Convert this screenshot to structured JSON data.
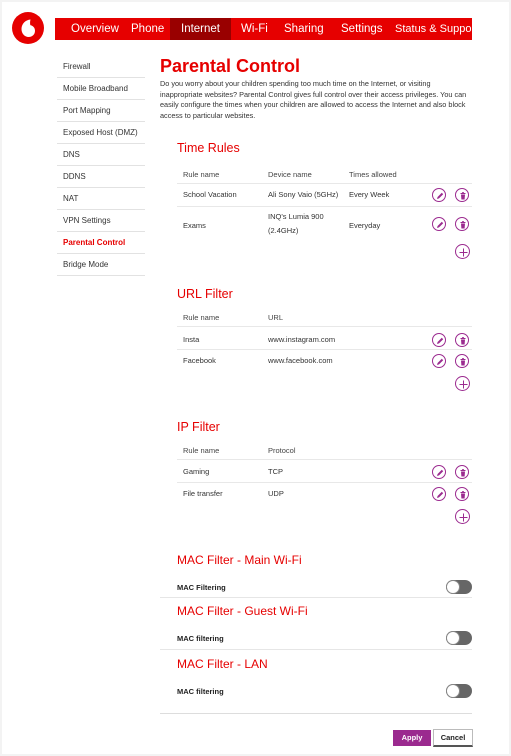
{
  "colors": {
    "brand": "#e60000",
    "brand_dark": "#990000",
    "action": "#9b2a8f"
  },
  "logo": {
    "icon": "vodafone-logo"
  },
  "nav": {
    "items": [
      {
        "label": "Overview"
      },
      {
        "label": "Phone"
      },
      {
        "label": "Internet",
        "active": true
      },
      {
        "label": "Wi-Fi"
      },
      {
        "label": "Sharing"
      },
      {
        "label": "Settings"
      },
      {
        "label": "Status & Support"
      }
    ]
  },
  "sidebar": {
    "items": [
      {
        "label": "Firewall"
      },
      {
        "label": "Mobile Broadband"
      },
      {
        "label": "Port Mapping"
      },
      {
        "label": "Exposed Host (DMZ)"
      },
      {
        "label": "DNS"
      },
      {
        "label": "DDNS"
      },
      {
        "label": "NAT"
      },
      {
        "label": "VPN Settings"
      },
      {
        "label": "Parental Control",
        "active": true
      },
      {
        "label": "Bridge Mode"
      }
    ]
  },
  "main": {
    "title": "Parental Control",
    "intro": "Do you worry about your children spending too much time on the Internet, or visiting inappropriate websites? Parental Control gives full control over their access privileges. You can easily configure the times when your children are allowed to access the Internet and also block access to particular websites."
  },
  "time_rules": {
    "title": "Time Rules",
    "headers": [
      "Rule name",
      "Device name",
      "Times allowed"
    ],
    "rows": [
      {
        "rule": "School Vacation",
        "device": "Ali Sony Vaio (5GHz)",
        "times": "Every Week"
      },
      {
        "rule": "Exams",
        "device_line1": "INQ's Lumia 900",
        "device_line2": "(2.4GHz)",
        "times": "Everyday"
      }
    ]
  },
  "url_filter": {
    "title": "URL Filter",
    "headers": [
      "Rule name",
      "URL"
    ],
    "rows": [
      {
        "rule": "Insta",
        "url": "www.instagram.com"
      },
      {
        "rule": "Facebook",
        "url": "www.facebook.com"
      }
    ]
  },
  "ip_filter": {
    "title": "IP Filter",
    "headers": [
      "Rule name",
      "Protocol"
    ],
    "rows": [
      {
        "rule": "Gaming",
        "protocol": "TCP"
      },
      {
        "rule": "File transfer",
        "protocol": "UDP"
      }
    ]
  },
  "mac_main": {
    "title": "MAC Filter - Main Wi-Fi",
    "label": "MAC Filtering",
    "enabled": false
  },
  "mac_guest": {
    "title": "MAC Filter - Guest Wi-Fi",
    "label": "MAC filtering",
    "enabled": false
  },
  "mac_lan": {
    "title": "MAC Filter - LAN",
    "label": "MAC filtering",
    "enabled": false
  },
  "actions": {
    "apply": "Apply",
    "cancel": "Cancel"
  },
  "icons": {
    "edit": "pencil-icon",
    "delete": "trash-icon",
    "add": "plus-icon"
  }
}
